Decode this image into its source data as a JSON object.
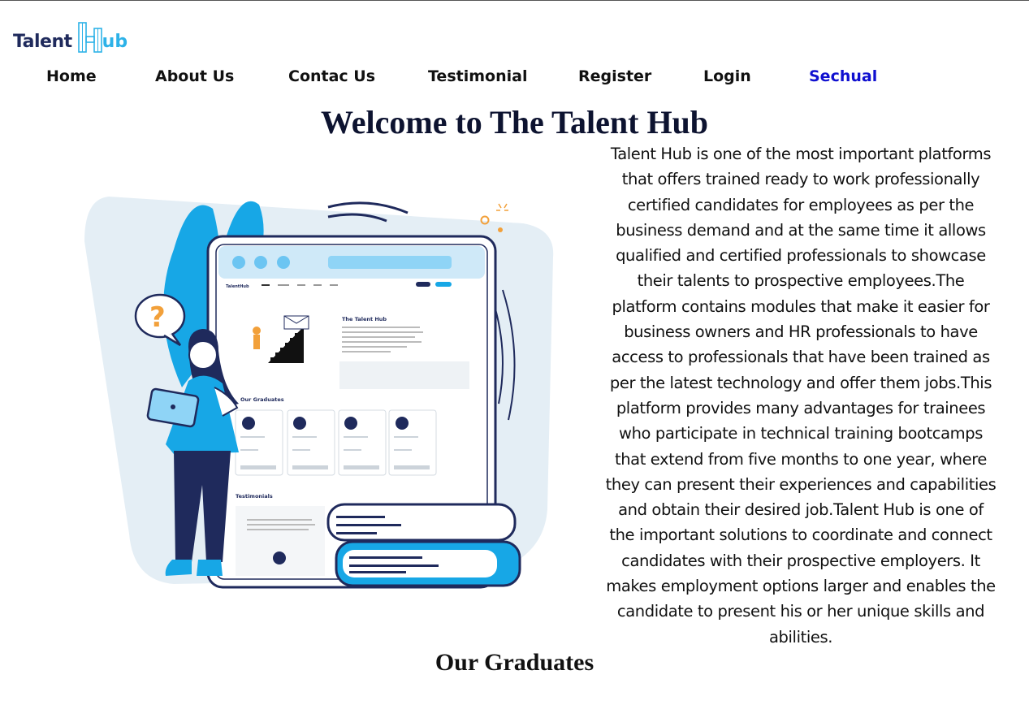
{
  "brand": {
    "name_part1": "Talent",
    "name_part2": "ub",
    "logo_letter": "H",
    "color_dark": "#1f2a5c",
    "color_accent": "#2db2e8"
  },
  "nav": {
    "items": [
      {
        "label": "Home"
      },
      {
        "label": "About Us"
      },
      {
        "label": "Contac Us"
      },
      {
        "label": "Testimonial"
      },
      {
        "label": "Register"
      },
      {
        "label": "Login"
      },
      {
        "label": "Sechual",
        "active": true
      }
    ],
    "active_color": "#1010d0"
  },
  "hero": {
    "title": "Welcome to The Talent Hub",
    "description": "Talent Hub is one of the most important platforms that offers trained ready to work professionally certified candidates for employees as per the business demand and at the same time it allows qualified and certified professionals to showcase their talents to prospective employees.The platform contains modules that make it easier for business owners and HR professionals to have access to professionals that have been trained as per the latest technology and offer them jobs.This platform provides many advantages for trainees who participate in technical training bootcamps that extend from five months to one year, where they can present their experiences and capabilities and obtain their desired job.Talent Hub is one of the important solutions to coordinate and connect candidates with their prospective employers. It makes employment options larger and enables the candidate to present his or her unique skills and abilities.",
    "illustration": {
      "icon": "woman-with-tablet-and-website-mockup-illustration",
      "mockup_site_title": "The Talent Hub",
      "mockup_section_graduates": "Our Graduates",
      "mockup_section_testimonials": "Testimonials",
      "question_mark": "?"
    }
  },
  "graduates": {
    "heading": "Our Graduates"
  }
}
